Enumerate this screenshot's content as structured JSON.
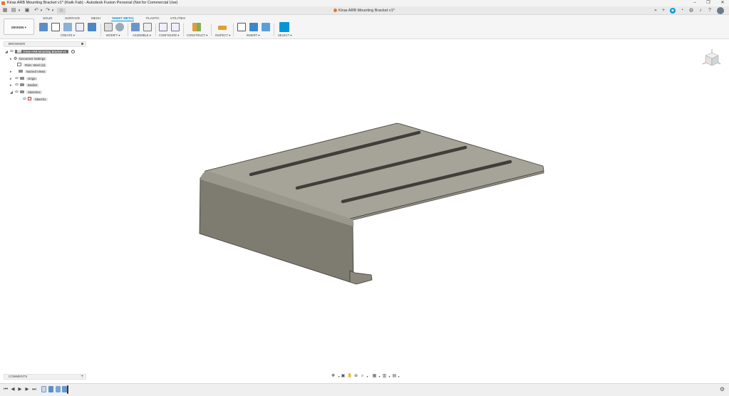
{
  "window": {
    "title": "Kiras ARB Mounting Bracket v1* (Kwik Fab) - Autodesk Fusion Personal (Not for Commercial Use)",
    "minimize_label": "–",
    "maximize_label": "❐",
    "close_label": "✕"
  },
  "document_tab": {
    "label": "Kiras ARB Mounting Bracket v1*",
    "close_label": "✕",
    "add_label": "+"
  },
  "workspace": {
    "label": "DESIGN ▾"
  },
  "tabs": [
    {
      "label": "SOLID",
      "active": false
    },
    {
      "label": "SURFACE",
      "active": false
    },
    {
      "label": "MESH",
      "active": false
    },
    {
      "label": "SHEET METAL",
      "active": true
    },
    {
      "label": "PLASTIC",
      "active": false
    },
    {
      "label": "UTILITIES",
      "active": false
    }
  ],
  "groups": {
    "create": "CREATE ▾",
    "modify": "MODIFY ▾",
    "assemble": "ASSEMBLE ▾",
    "configure": "CONFIGURE ▾",
    "construct": "CONSTRUCT ▾",
    "inspect": "INSPECT ▾",
    "insert": "INSERT ▾",
    "select": "SELECT ▾"
  },
  "browser": {
    "title": "BROWSER",
    "root": "Kiras ARB Mounting Bracket v1",
    "items": [
      {
        "label": "Document Settings"
      },
      {
        "label": "Rule: Steel (in)"
      },
      {
        "label": "Named Views"
      },
      {
        "label": "Origin"
      },
      {
        "label": "Bodies"
      },
      {
        "label": "Sketches"
      },
      {
        "label": "Sketch1"
      }
    ]
  },
  "comments": {
    "label": "COMMENTS",
    "add_label": "+"
  },
  "colors": {
    "accent": "#0696d7",
    "brand": "#e8762c",
    "body_top": "#a8a59b",
    "body_front": "#7f7c72",
    "edge": "#3a3a36"
  },
  "icons": {
    "grid": "grid-icon",
    "file": "file-icon",
    "save": "save-icon",
    "undo": "undo-icon",
    "redo": "redo-icon",
    "home": "home-icon",
    "settings": "gear-icon"
  }
}
